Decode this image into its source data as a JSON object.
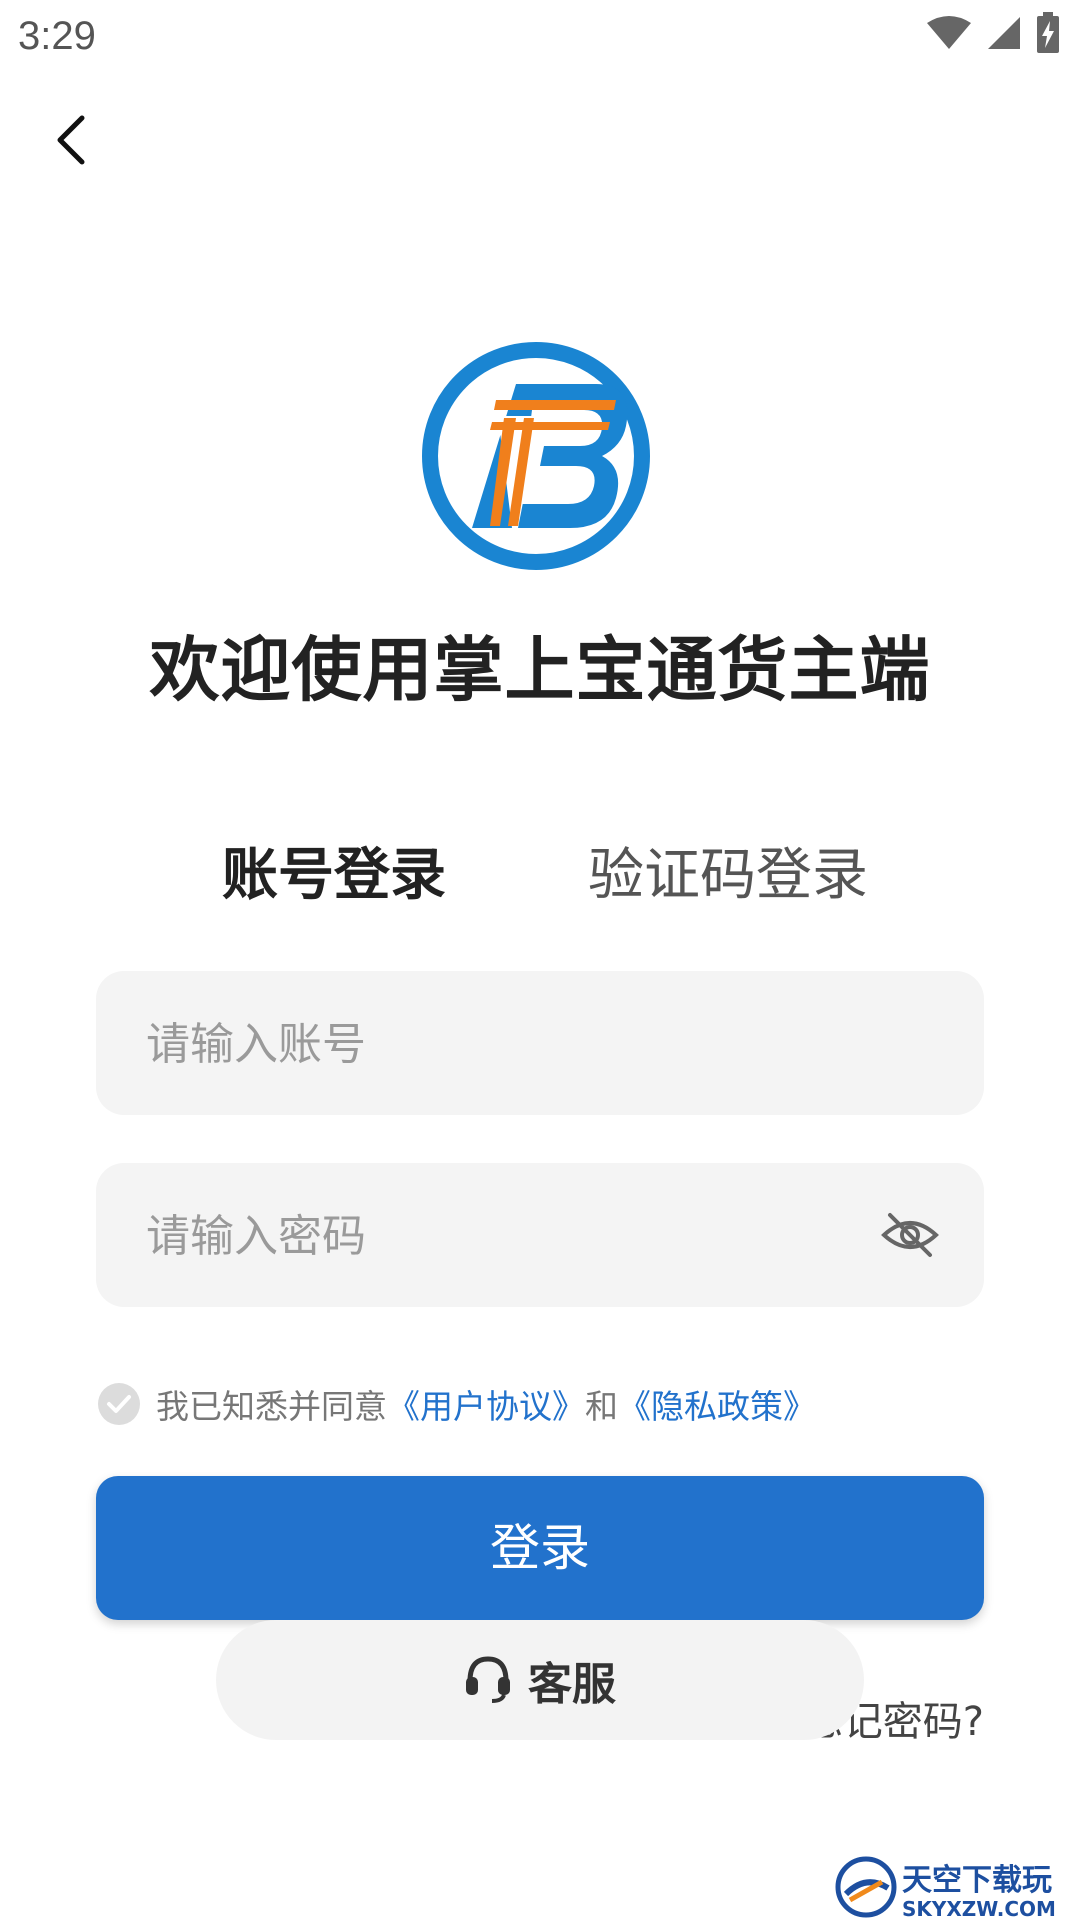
{
  "status_bar": {
    "time": "3:29",
    "icons": [
      "wifi-icon",
      "cellular-signal-icon",
      "battery-charging-icon"
    ]
  },
  "nav": {
    "back_icon": "chevron-left-icon"
  },
  "logo": {
    "name": "app-logo",
    "colors": {
      "ring": "#1a85d2",
      "letter": "#1a85d2",
      "stripes": "#f07f1c"
    }
  },
  "welcome": {
    "title": "欢迎使用掌上宝通货主端"
  },
  "tabs": [
    {
      "label": "账号登录",
      "active": true
    },
    {
      "label": "验证码登录",
      "active": false
    }
  ],
  "form": {
    "account_placeholder": "请输入账号",
    "password_placeholder": "请输入密码",
    "password_toggle_icon": "eye-off-icon"
  },
  "agreement": {
    "prefix": "我已知悉并同意",
    "user_agreement": "《用户协议》",
    "and": "和",
    "privacy_policy": "《隐私政策》",
    "checked": true
  },
  "login_button": {
    "label": "登录"
  },
  "forgot_password": {
    "label": "忘记密码?"
  },
  "customer_service": {
    "label": "客服",
    "icon": "headset-icon"
  },
  "watermark": {
    "brand": "天空下载玩",
    "url": "SKYXZW.COM"
  },
  "colors": {
    "accent": "#2272cc",
    "input_bg": "#f4f4f4",
    "placeholder": "#9a9a9a"
  }
}
